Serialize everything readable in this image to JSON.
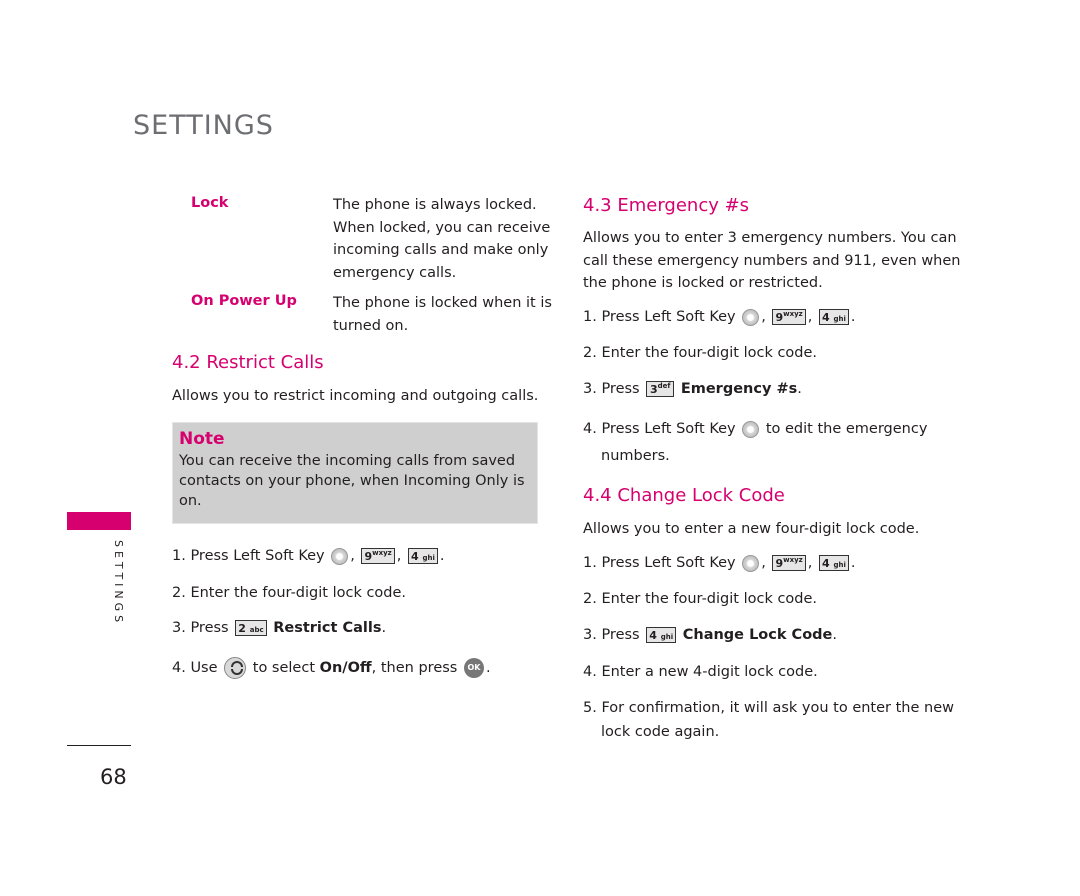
{
  "header": {
    "title": "SETTINGS"
  },
  "sidebar": {
    "label": "SETTINGS",
    "accent_color": "#d6006f"
  },
  "footer": {
    "page_number": "68"
  },
  "left_column": {
    "definitions": [
      {
        "term": "Lock",
        "lines": [
          "The phone is always locked.",
          "When locked, you can receive",
          "incoming calls and make only",
          "emergency calls."
        ]
      },
      {
        "term": "On Power Up",
        "lines": [
          "The phone is locked when it is",
          "turned on."
        ]
      }
    ],
    "section": {
      "title": "4.2 Restrict Calls",
      "intro": "Allows you to restrict incoming and outgoing calls.",
      "note": {
        "title": "Note",
        "lines": [
          "You can receive the incoming calls from saved",
          "contacts on your phone, when Incoming Only is",
          "on."
        ]
      },
      "steps": {
        "s1_prefix": "1. Press Left Soft Key",
        "s2": "2. Enter the four-digit lock code.",
        "s3_prefix": "3. Press",
        "s3_bold": "Restrict Calls",
        "s4_prefix": "4. Use",
        "s4_mid": "to select",
        "s4_bold": "On/Off",
        "s4_suffix": ", then press"
      }
    }
  },
  "keys": {
    "key9": {
      "digit": "9",
      "letters": "wxyz"
    },
    "key4": {
      "digit": "4",
      "letters": "ghi"
    },
    "key2": {
      "digit": "2",
      "letters": "abc"
    },
    "key3": {
      "digit": "3",
      "letters": "def"
    },
    "ok": "OK",
    "comma": ",",
    "period": "."
  },
  "right_column": {
    "emergency": {
      "title": "4.3 Emergency #s",
      "intro": [
        "Allows you to enter 3 emergency numbers. You can",
        "call these emergency numbers and 911, even when",
        "the phone is locked or restricted."
      ],
      "s1_prefix": "1. Press Left Soft Key",
      "s2": "2. Enter the four-digit lock code.",
      "s3_prefix": "3. Press",
      "s3_bold": "Emergency #s",
      "s4_prefix": "4. Press Left Soft Key",
      "s4_suffix": "to edit the emergency",
      "s4_line2": "numbers."
    },
    "change_lock": {
      "title": "4.4 Change Lock Code",
      "intro": "Allows you to enter a new four-digit lock code.",
      "s1_prefix": "1. Press Left Soft Key",
      "s2": "2. Enter the four-digit lock code.",
      "s3_prefix": "3. Press",
      "s3_bold": "Change Lock Code",
      "s4": "4. Enter a new 4-digit lock code.",
      "s5_line1": "5. For confirmation, it will ask you to enter the new",
      "s5_line2": "lock code again."
    }
  }
}
